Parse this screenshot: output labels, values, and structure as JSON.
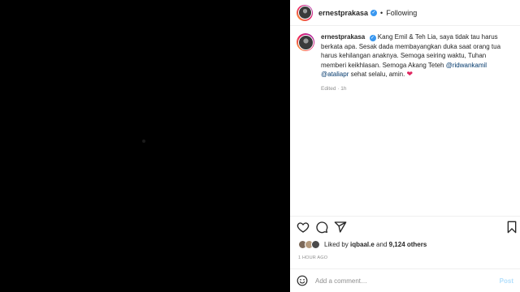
{
  "colors": {
    "verified": "#3897f0",
    "mention": "#00376b",
    "heart": "#e0245e",
    "post_disabled": "#b2dffc"
  },
  "header": {
    "username": "ernestprakasa",
    "separator": "•",
    "follow_state": "Following",
    "verified_icon": "verified-badge-icon"
  },
  "caption": {
    "username": "ernestprakasa",
    "text_part1": "Kang Emil & Teh Lia, saya tidak tau harus berkata apa. Sesak dada membayangkan duka saat orang tua harus kehilangan anaknya. Semoga seiring waktu, Tuhan memberi keikhlasan. Semoga Akang Teteh ",
    "mention1": "@ridwankamil",
    "mention2": "@ataliapr",
    "text_part2": " sehat selalu, amin. ",
    "heart": "❤",
    "meta": "Edited · 1h"
  },
  "actions": {
    "like_icon": "heart-icon",
    "comment_icon": "comment-icon",
    "share_icon": "share-icon",
    "save_icon": "bookmark-icon"
  },
  "likes": {
    "prefix": "Liked by ",
    "user": "iqbaal.e",
    "middle": " and ",
    "others": "9,124 others"
  },
  "timestamp": "1 HOUR AGO",
  "comment": {
    "emoji_icon": "emoji-icon",
    "placeholder": "Add a comment…",
    "post_label": "Post"
  }
}
